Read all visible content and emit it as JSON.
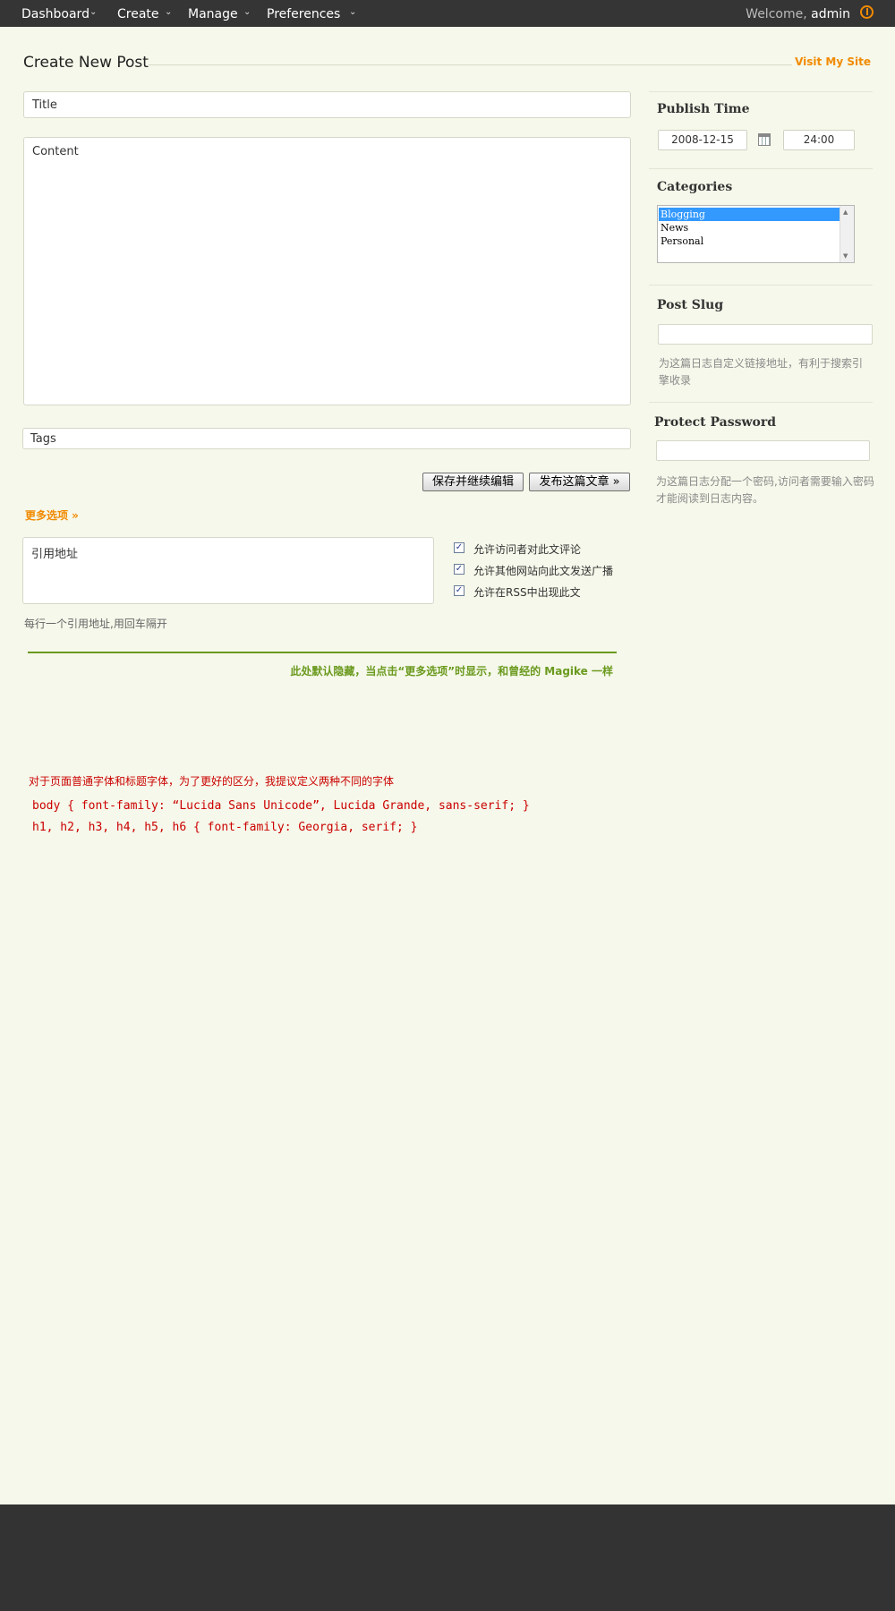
{
  "nav": {
    "items": [
      "Dashboard",
      "Create",
      "Manage",
      "Preferences"
    ],
    "welcome_prefix": "Welcome,",
    "username": "admin"
  },
  "page": {
    "title": "Create New Post",
    "visit_link": "Visit My Site"
  },
  "editor": {
    "title_placeholder": "Title",
    "content_placeholder": "Content",
    "tags_placeholder": "Tags"
  },
  "buttons": {
    "save": "保存并继续编辑",
    "publish": "发布这篇文章 »"
  },
  "more_options": {
    "link": "更多选项 »",
    "trackback_placeholder": "引用地址",
    "trackback_hint": "每行一个引用地址,用回车隔开",
    "checkboxes": [
      {
        "label": "允许访问者对此文评论",
        "checked": true
      },
      {
        "label": "允许其他网站向此文发送广播",
        "checked": true
      },
      {
        "label": "允许在RSS中出现此文",
        "checked": true
      }
    ]
  },
  "notes": {
    "hidden_note": "此处默认隐藏，当点击“更多选项”时显示，和曾经的 Magike 一样",
    "font_note": "对于页面普通字体和标题字体，为了更好的区分，我提议定义两种不同的字体",
    "code_lines": [
      "body { font-family: “Lucida Sans Unicode”, Lucida Grande, sans-serif; }",
      "h1, h2, h3, h4, h5, h6 { font-family: Georgia, serif; }"
    ]
  },
  "sidebar": {
    "publish_time": {
      "heading": "Publish Time",
      "date": "2008-12-15",
      "time": "24:00"
    },
    "categories": {
      "heading": "Categories",
      "options": [
        "Blogging",
        "News",
        "Personal"
      ],
      "selected": "Blogging"
    },
    "slug": {
      "heading": "Post Slug",
      "value": "",
      "hint": "为这篇日志自定义链接地址，有利于搜索引擎收录"
    },
    "password": {
      "heading": "Protect Password",
      "value": "",
      "hint": "为这篇日志分配一个密码,访问者需要输入密码才能阅读到日志内容。"
    }
  },
  "colors": {
    "background": "#f5f8ea",
    "topbar": "#353535",
    "accent_orange": "#f28a00",
    "note_green": "#6b9a1f",
    "note_red": "#cc0000"
  }
}
